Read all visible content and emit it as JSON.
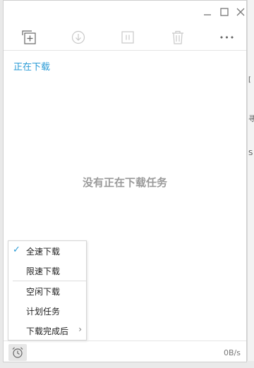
{
  "window": {
    "controls": {
      "minimize": "—",
      "maximize": "□",
      "close": "✕"
    }
  },
  "toolbar": {
    "new_task_icon": "add-task-icon",
    "download_icon": "download-icon",
    "pause_icon": "pause-icon",
    "delete_icon": "trash-icon",
    "more_label": "•••"
  },
  "section": {
    "title": "正在下载"
  },
  "empty_message": "没有正在下载任务",
  "speed_menu": {
    "items": [
      {
        "label": "全速下载",
        "checked": true
      },
      {
        "label": "限速下载"
      },
      {
        "label": "空闲下载"
      },
      {
        "label": "计划任务"
      },
      {
        "label": "下载完成后",
        "has_submenu": true
      }
    ],
    "check_glyph": "✓",
    "submenu_glyph": "›"
  },
  "status": {
    "speed": "0B/s"
  },
  "colors": {
    "accent": "#2a9bd6",
    "muted": "#9a9a9a"
  }
}
